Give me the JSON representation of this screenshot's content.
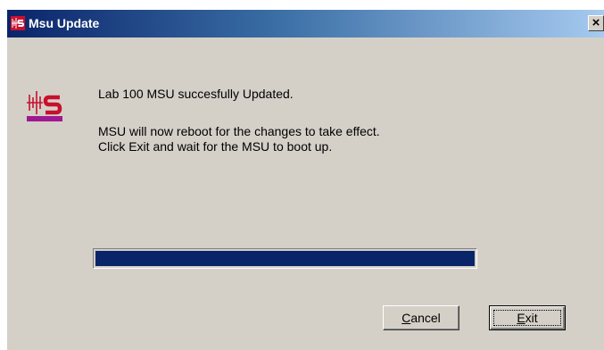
{
  "window": {
    "title": "Msu Update",
    "close_glyph": "×",
    "title_icon": "app-logo-icon"
  },
  "messages": {
    "line1": "Lab 100 MSU succesfully Updated.",
    "line2": "MSU will now reboot for the changes to take effect.",
    "line3": "Click Exit and wait for the MSU to boot up."
  },
  "progress": {
    "percent": 100
  },
  "buttons": {
    "cancel_label": "Cancel",
    "exit_label": "Exit"
  },
  "colors": {
    "titlebar_start": "#0a246a",
    "titlebar_end": "#a6caf0",
    "logo_red": "#c8102e",
    "logo_purple": "#a01890",
    "progress_fill": "#0a246a",
    "dialog_bg": "#d4d0c8"
  }
}
